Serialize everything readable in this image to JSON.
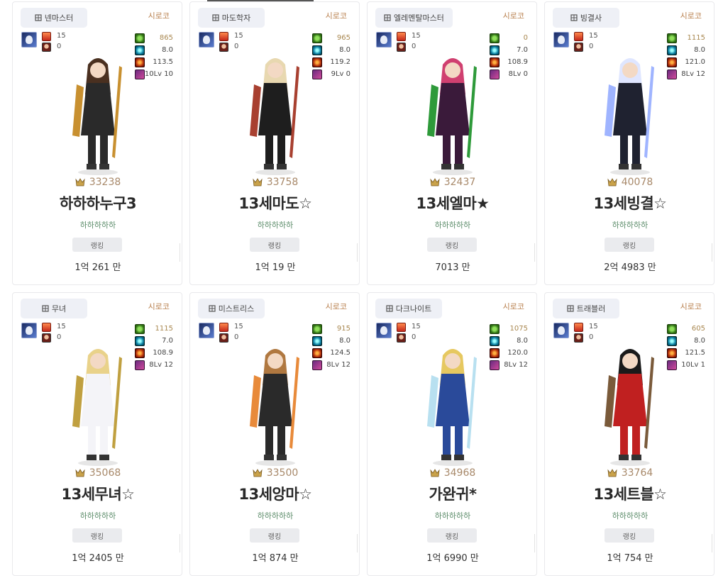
{
  "cards": [
    {
      "job": "넨마스터",
      "server": "시로코",
      "level": "15",
      "pet": "0",
      "stats": [
        "865",
        "8.0",
        "113.5",
        "10Lv 10"
      ],
      "fame": "33238",
      "name": "하하하누구3",
      "guild": "하하하하하",
      "rank_label": "랭킹",
      "damage": "1억 261 만",
      "palette": {
        "hair": "#4a3020",
        "outfit": "#2a2a2a",
        "accent": "#c89030"
      }
    },
    {
      "job": "마도학자",
      "server": "시로코",
      "level": "15",
      "pet": "0",
      "stats": [
        "965",
        "8.0",
        "119.2",
        "9Lv 0"
      ],
      "fame": "33758",
      "name": "13세마도☆",
      "guild": "하하하하하",
      "rank_label": "랭킹",
      "damage": "1억 19 만",
      "palette": {
        "hair": "#e8d8b0",
        "outfit": "#1e1e1e",
        "accent": "#a84030"
      }
    },
    {
      "job": "엘레멘탈마스터",
      "server": "시로코",
      "level": "15",
      "pet": "0",
      "stats": [
        "0",
        "7.0",
        "108.9",
        "8Lv 0"
      ],
      "fame": "32437",
      "name": "13세엘마★",
      "guild": "하하하하하",
      "rank_label": "랭킹",
      "damage": "7013 만",
      "palette": {
        "hair": "#d04070",
        "outfit": "#3a1a3a",
        "accent": "#2e9a3a"
      }
    },
    {
      "job": "빙결사",
      "server": "시로코",
      "level": "15",
      "pet": "0",
      "stats": [
        "1115",
        "8.0",
        "121.0",
        "8Lv 12"
      ],
      "fame": "40078",
      "name": "13세빙결☆",
      "guild": "하하하하하",
      "rank_label": "랭킹",
      "damage": "2억 4983 만",
      "palette": {
        "hair": "#dfe6ff",
        "outfit": "#1f2230",
        "accent": "#9fb4ff"
      }
    },
    {
      "job": "무녀",
      "server": "시로코",
      "level": "15",
      "pet": "0",
      "stats": [
        "1115",
        "7.0",
        "108.9",
        "8Lv 12"
      ],
      "fame": "35068",
      "name": "13세무녀☆",
      "guild": "하하하하하",
      "rank_label": "랭킹",
      "damage": "1억 2405 만",
      "palette": {
        "hair": "#e9d28a",
        "outfit": "#f4f4f8",
        "accent": "#c0a040"
      }
    },
    {
      "job": "미스트리스",
      "server": "시로코",
      "level": "15",
      "pet": "0",
      "stats": [
        "915",
        "8.0",
        "124.5",
        "8Lv 12"
      ],
      "fame": "33500",
      "name": "13세앙마☆",
      "guild": "하하하하하",
      "rank_label": "랭킹",
      "damage": "1억 874 만",
      "palette": {
        "hair": "#b07840",
        "outfit": "#2a2a2a",
        "accent": "#e88a3a"
      }
    },
    {
      "job": "다크나이트",
      "server": "시로코",
      "level": "15",
      "pet": "0",
      "stats": [
        "1075",
        "8.0",
        "120.0",
        "8Lv 12"
      ],
      "fame": "34968",
      "name": "가완귀*",
      "guild": "하하하하하",
      "rank_label": "랭킹",
      "damage": "1억 6990 만",
      "palette": {
        "hair": "#e6c860",
        "outfit": "#2a4a9a",
        "accent": "#b8e0f0"
      }
    },
    {
      "job": "트래블러",
      "server": "시로코",
      "level": "15",
      "pet": "0",
      "stats": [
        "605",
        "8.0",
        "121.5",
        "10Lv 1"
      ],
      "fame": "33764",
      "name": "13세트블☆",
      "guild": "하하하하하",
      "rank_label": "랭킹",
      "damage": "1억 754 만",
      "palette": {
        "hair": "#1a1a1a",
        "outfit": "#c02020",
        "accent": "#7a5a3a"
      }
    }
  ]
}
